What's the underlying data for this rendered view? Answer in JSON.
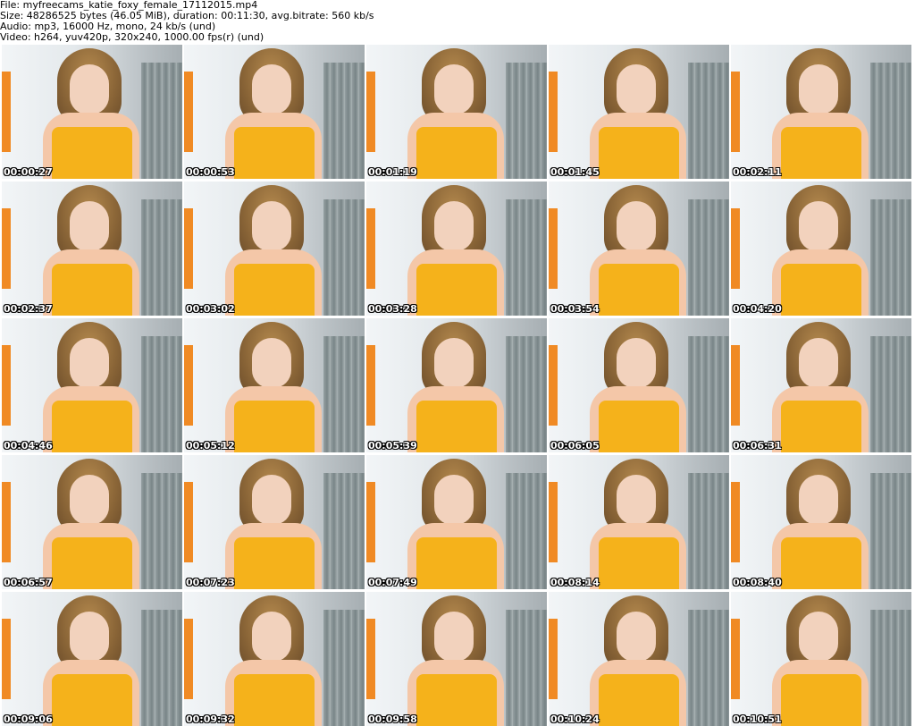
{
  "header": {
    "file_line": "File: myfreecams_katie_foxy_female_17112015.mp4",
    "size_line": "Size: 48286525 bytes (46.05 MiB), duration: 00:11:30, avg.bitrate: 560 kb/s",
    "audio_line": "Audio: mp3, 16000 Hz, mono, 24 kb/s (und)",
    "video_line": "Video: h264, yuv420p, 320x240, 1000.00 fps(r) (und)"
  },
  "thumbnails": [
    {
      "timestamp": "00:00:27"
    },
    {
      "timestamp": "00:00:53"
    },
    {
      "timestamp": "00:01:19"
    },
    {
      "timestamp": "00:01:45"
    },
    {
      "timestamp": "00:02:11"
    },
    {
      "timestamp": "00:02:37"
    },
    {
      "timestamp": "00:03:02"
    },
    {
      "timestamp": "00:03:28"
    },
    {
      "timestamp": "00:03:54"
    },
    {
      "timestamp": "00:04:20"
    },
    {
      "timestamp": "00:04:46"
    },
    {
      "timestamp": "00:05:12"
    },
    {
      "timestamp": "00:05:39"
    },
    {
      "timestamp": "00:06:05"
    },
    {
      "timestamp": "00:06:31"
    },
    {
      "timestamp": "00:06:57"
    },
    {
      "timestamp": "00:07:23"
    },
    {
      "timestamp": "00:07:49"
    },
    {
      "timestamp": "00:08:14"
    },
    {
      "timestamp": "00:08:40"
    },
    {
      "timestamp": "00:09:06"
    },
    {
      "timestamp": "00:09:32"
    },
    {
      "timestamp": "00:09:58"
    },
    {
      "timestamp": "00:10:24"
    },
    {
      "timestamp": "00:10:51"
    }
  ]
}
